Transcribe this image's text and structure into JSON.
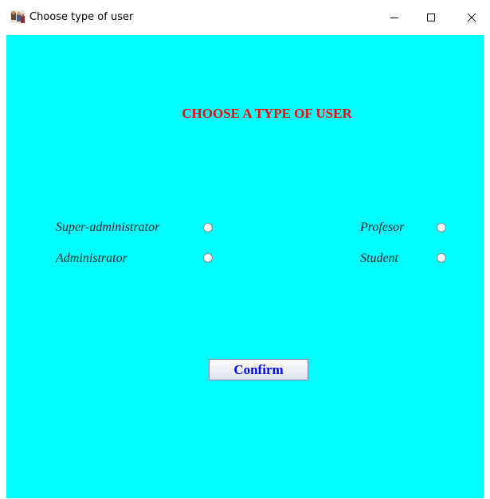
{
  "window": {
    "title": "Choose type of user"
  },
  "heading": "CHOOSE A TYPE OF USER",
  "options": [
    {
      "label": "Super-administrator",
      "selected": false
    },
    {
      "label": "Administrator",
      "selected": false
    },
    {
      "label": "Profesor",
      "selected": false
    },
    {
      "label": "Student",
      "selected": false
    }
  ],
  "confirm_label": "Confirm",
  "colors": {
    "background": "#00ffff",
    "heading": "#ff0000",
    "button_text": "#0000ff"
  },
  "icons": {
    "app": "app-icon",
    "minimize": "minimize-icon",
    "maximize": "maximize-icon",
    "close": "close-icon"
  }
}
